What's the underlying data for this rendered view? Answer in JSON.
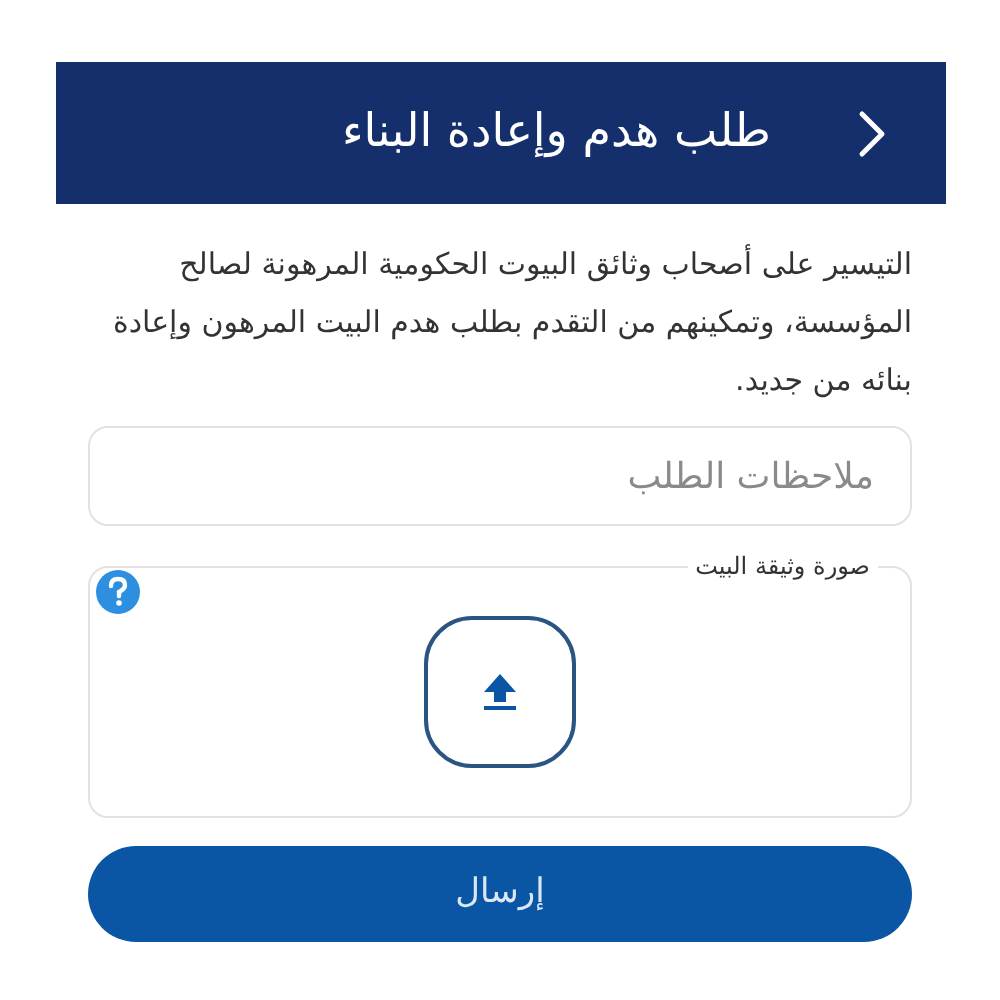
{
  "header": {
    "title": "طلب هدم وإعادة البناء"
  },
  "description": "التيسير على أصحاب وثائق البيوت الحكومية المرهونة لصالح المؤسسة، وتمكينهم من التقدم بطلب هدم البيت المرهون وإعادة بنائه من جديد.",
  "notes_field": {
    "placeholder": "ملاحظات الطلب"
  },
  "upload": {
    "label": "صورة وثيقة البيت"
  },
  "submit_button": {
    "label": "إرسال"
  }
}
